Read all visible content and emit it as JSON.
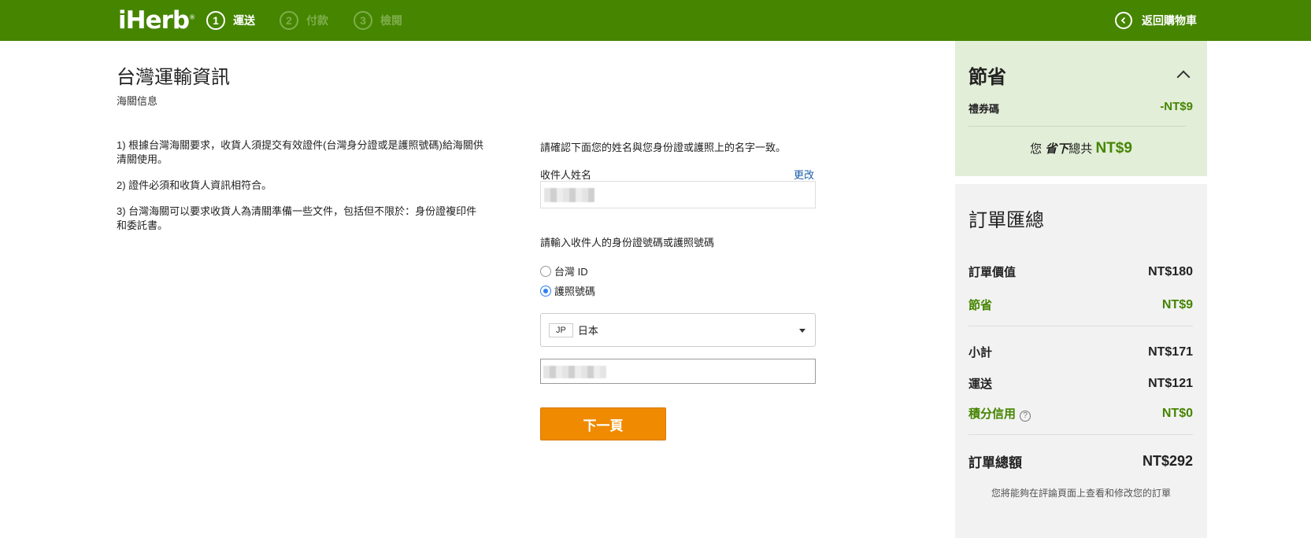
{
  "header": {
    "logo": "iHerb",
    "logo_reg": "®",
    "steps": [
      {
        "num": "1",
        "label": "運送"
      },
      {
        "num": "2",
        "label": "付款"
      },
      {
        "num": "3",
        "label": "檢閱"
      }
    ],
    "back_cart": "返回購物車",
    "colors": {
      "brand": "#458500",
      "accent": "#f08a00"
    }
  },
  "main": {
    "title": "台灣運輸資訊",
    "subtitle": "海關信息",
    "rules": [
      "1) 根據台灣海關要求，收貨人須提交有效證件(台灣身分證或是護照號碼)給海關供清關使用。",
      "2) 證件必須和收貨人資訊相符合。",
      "3) 台灣海關可以要求收貨人為清關準備一些文件，包括但不限於：身份證複印件和委託書。"
    ]
  },
  "form": {
    "confirm_note": "請確認下面您的姓名與您身份證或護照上的名字一致。",
    "recipient_label": "收件人姓名",
    "edit_link": "更改",
    "id_prompt": "請輸入收件人的身份證號碼或護照號碼",
    "radio_options": [
      {
        "label": "台灣 ID",
        "checked": false
      },
      {
        "label": "護照號碼",
        "checked": true
      }
    ],
    "country": {
      "code": "JP",
      "name": "日本"
    },
    "next_button": "下一頁"
  },
  "savings": {
    "title": "節省",
    "coupon_label": "禮券碼",
    "coupon_value": "-NT$9",
    "total_prefix": "您",
    "total_em": "省下",
    "total_mid": "總共",
    "total_amount": "NT$9"
  },
  "summary": {
    "title": "訂單匯總",
    "rows": [
      {
        "label": "訂單價值",
        "value": "NT$180"
      },
      {
        "label": "節省",
        "value": "NT$9"
      },
      {
        "label": "小計",
        "value": "NT$171"
      },
      {
        "label": "運送",
        "value": "NT$121"
      },
      {
        "label": "積分信用",
        "value": "NT$0"
      }
    ],
    "total_label": "訂單總額",
    "total_value": "NT$292",
    "review_note": "您將能夠在評論頁面上查看和修改您的訂單"
  }
}
